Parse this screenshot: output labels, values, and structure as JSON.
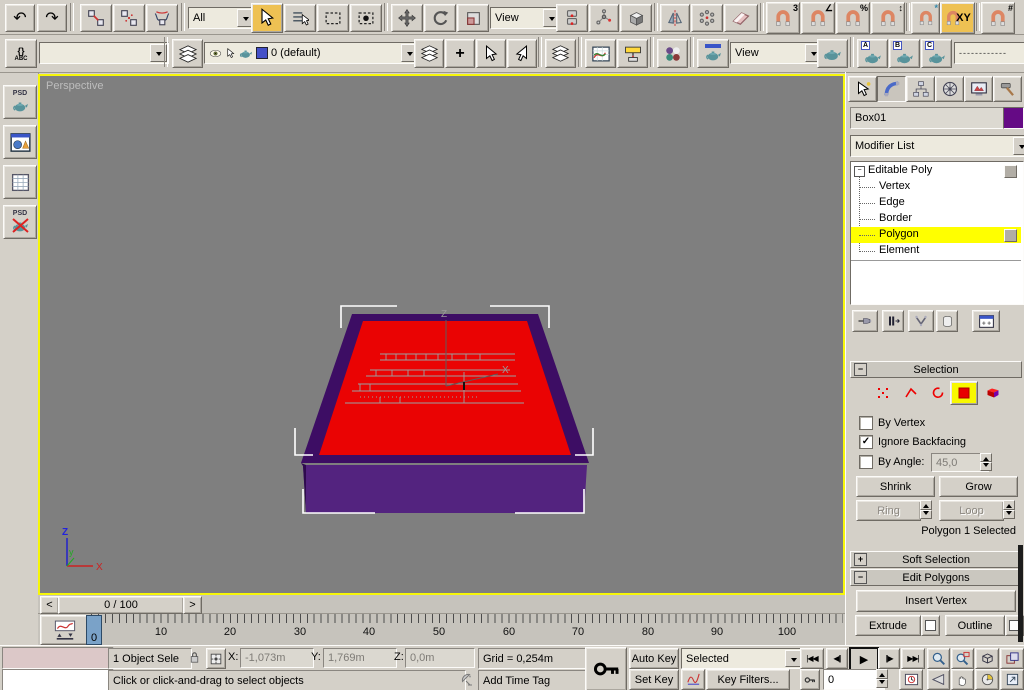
{
  "icons": {
    "undo": "↶",
    "redo": "↷",
    "check": "✓",
    "minus": "−",
    "plus": "+",
    "snap3": "3",
    "angle_glyph": "∠",
    "snap_pct": "%",
    "spin_glyph": "↕",
    "snow_glyph": "*",
    "grid_glyph": "#",
    "go_start": "|◀◀",
    "frame_prev": "◀||",
    "play": "▶",
    "frame_next": "||▶",
    "go_end": "▶▶|",
    "slider_prev": "<",
    "slider_next": ">"
  },
  "toolbar": {
    "selection_filter": "All",
    "coord_system": "View",
    "axis_constraint": "XY",
    "named_sets_brace": "{}",
    "named_sets_abc": "ABC",
    "layer_current": "0 (default)",
    "render_type": "View",
    "preset_a": "A",
    "preset_b": "B",
    "preset_c": "C",
    "render_preset_value": "------------"
  },
  "left_toolbar": {
    "psd_render": "PSD",
    "psd_off": "PSD"
  },
  "viewport": {
    "label": "Perspective",
    "gizmo_z": "Z",
    "gizmo_x": "X",
    "axis_z": "Z",
    "axis_y": "y",
    "axis_x": "X"
  },
  "panel": {
    "object_name": "Box01",
    "modifier_list": "Modifier List",
    "stack": [
      {
        "label": "Editable Poly"
      },
      {
        "label": "Vertex"
      },
      {
        "label": "Edge"
      },
      {
        "label": "Border"
      },
      {
        "label": "Polygon"
      },
      {
        "label": "Element"
      }
    ],
    "selection": {
      "title": "Selection",
      "by_vertex": "By Vertex",
      "ignore_backfacing": "Ignore Backfacing",
      "by_angle": "By Angle:",
      "by_angle_value": "45,0",
      "shrink": "Shrink",
      "grow": "Grow",
      "ring": "Ring",
      "loop": "Loop",
      "status": "Polygon 1 Selected"
    },
    "soft_selection_title": "Soft Selection",
    "edit_polygons_title": "Edit Polygons",
    "insert_vertex": "Insert Vertex",
    "extrude": "Extrude",
    "outline": "Outline"
  },
  "timeline": {
    "slider_label": "0 / 100",
    "current_frame": "0",
    "ticks": [
      "0",
      "10",
      "20",
      "30",
      "40",
      "50",
      "60",
      "70",
      "80",
      "90",
      "100"
    ]
  },
  "status": {
    "selection_count": "1 Object Sele",
    "x_label": "X:",
    "x_value": "-1,073m",
    "y_label": "Y:",
    "y_value": "1,769m",
    "z_label": "Z:",
    "z_value": "0,0m",
    "grid": "Grid = 0,254m",
    "prompt": "Click or click-and-drag to select objects",
    "add_time_tag": "Add Time Tag",
    "auto_key": "Auto Key",
    "set_key": "Set Key",
    "key_scope": "Selected",
    "key_filters": "Key Filters...",
    "frame_value": "0"
  },
  "colors": {
    "ui_bg": "#d4d0c8",
    "viewport_bg": "#7f7f7f",
    "active_border": "#f6f60a",
    "highlight": "#ffff00",
    "active_button": "#eec153",
    "object_color": "#650a85",
    "selected_face": "#ea0303",
    "object_rim": "#3d0d64",
    "object_front": "#53237f",
    "frame_marker": "#7aa2c8"
  }
}
